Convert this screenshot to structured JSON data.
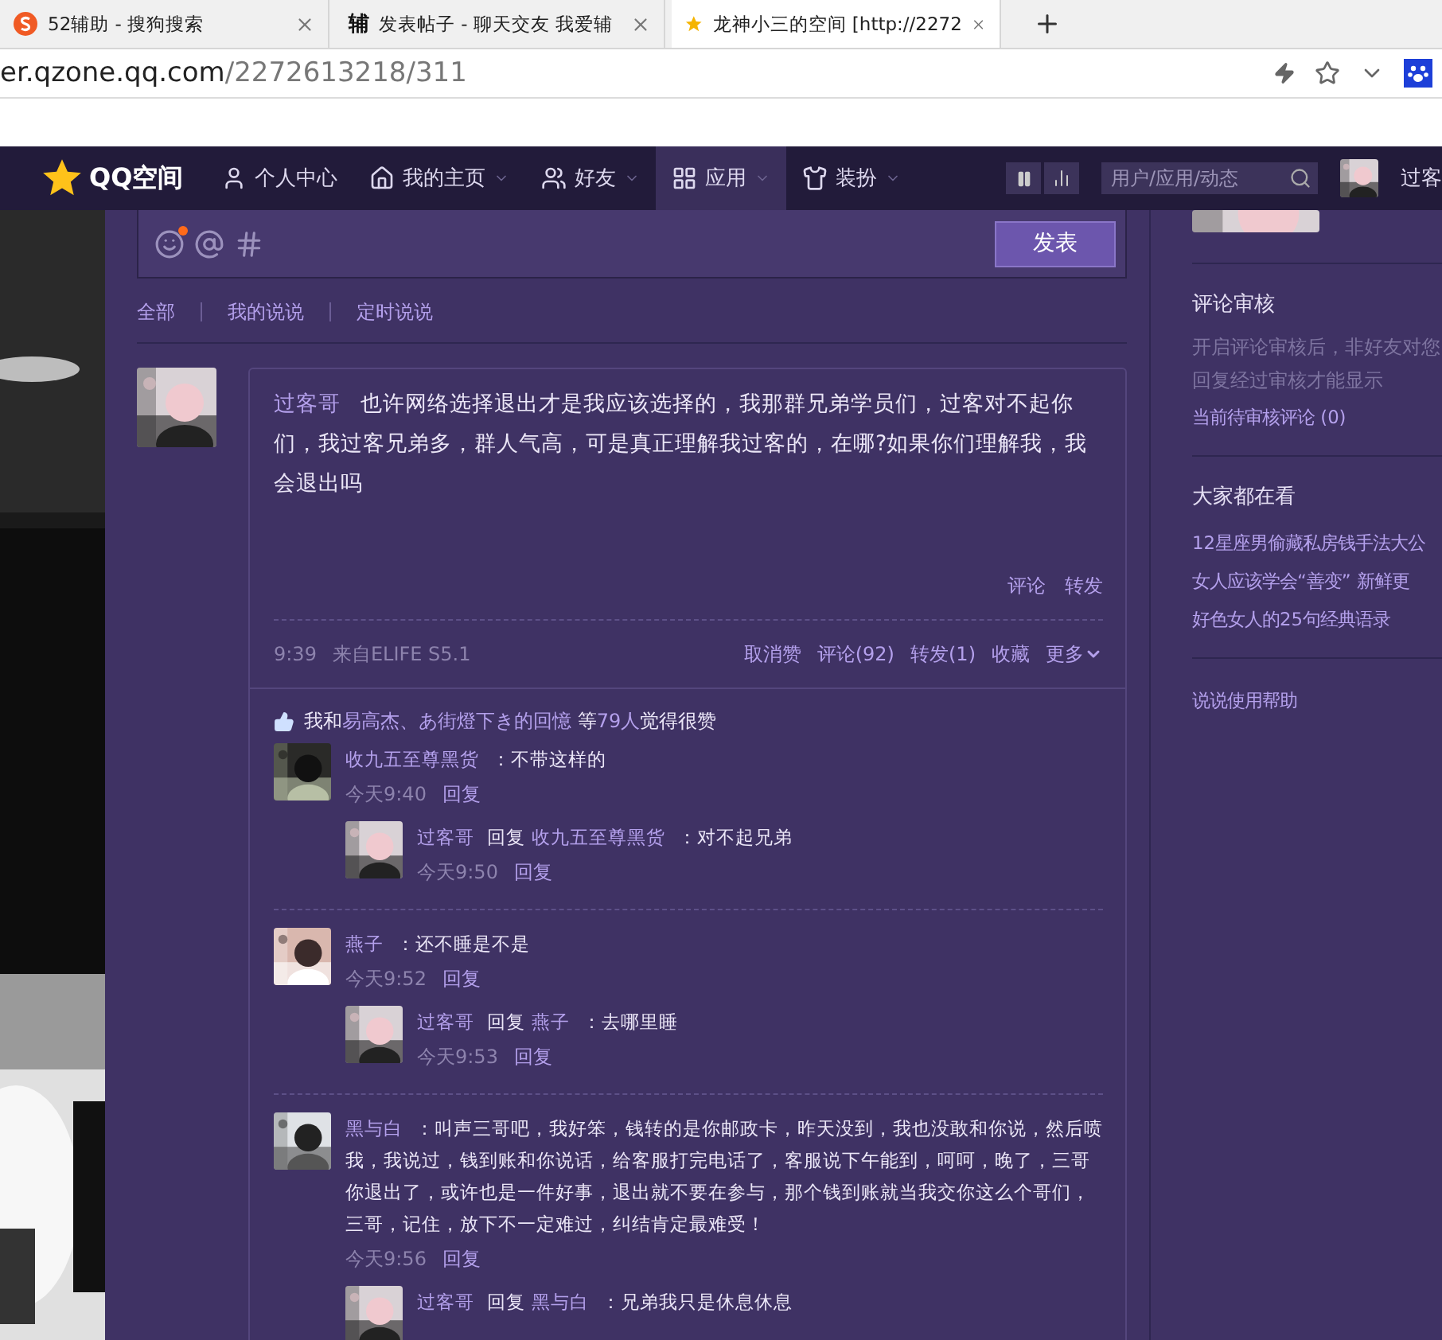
{
  "browser": {
    "tabs": [
      {
        "title": "52辅助 - 搜狗搜索",
        "selected": false
      },
      {
        "title": "发表帖子 - 聊天交友 我爱辅",
        "favicon": "辅",
        "selected": false
      },
      {
        "title": "龙神小三的空间 [http://2272",
        "selected": true
      }
    ],
    "address": {
      "host": "er.qzone.qq.com",
      "path": "/2272613218/311"
    }
  },
  "nav": {
    "logo": "QQ空间",
    "items": [
      {
        "label": "个人中心",
        "dropdown": false,
        "selected": false
      },
      {
        "label": "我的主页",
        "dropdown": true,
        "selected": false
      },
      {
        "label": "好友",
        "dropdown": true,
        "selected": false
      },
      {
        "label": "应用",
        "dropdown": true,
        "selected": true
      },
      {
        "label": "装扮",
        "dropdown": true,
        "selected": false
      }
    ],
    "search": {
      "placeholder": "用户/应用/动态"
    },
    "user": "过客"
  },
  "composer": {
    "emoji_dot": true,
    "button": "发表"
  },
  "filters": [
    "全部",
    "我的说说",
    "定时说说"
  ],
  "post": {
    "author": "过客哥",
    "text": "也许网络选择退出才是我应该选择的，我那群兄弟学员们，过客对不起你们，我过客兄弟多，群人气高，可是真正理解我过客的，在哪?如果你们理解我，我会退出吗",
    "inner_actions": [
      "评论",
      "转发"
    ],
    "time": "9:39",
    "source": "来自ELIFE S5.1",
    "actions": [
      "取消赞",
      "评论(92)",
      "转发(1)",
      "收藏",
      "更多"
    ],
    "likes": [
      {
        "text": "我和",
        "link": false
      },
      {
        "text": "易高杰、",
        "link": true
      },
      {
        "text": "あ街燈下き的回憶",
        "link": true
      },
      {
        "text": " 等",
        "link": false
      },
      {
        "text": "79人",
        "link": true
      },
      {
        "text": "觉得很赞",
        "link": false
      }
    ],
    "comments": [
      {
        "author": "收九五至尊黑货",
        "text": "：不带这样的",
        "time": "今天9:40",
        "reply": "回复",
        "replies": [
          {
            "author": "过客哥",
            "verb": "回复",
            "target": "收九五至尊黑货",
            "text": "：对不起兄弟",
            "time": "今天9:50",
            "reply": "回复"
          }
        ]
      },
      {
        "author": "燕子",
        "text": "：还不睡是不是",
        "time": "今天9:52",
        "reply": "回复",
        "replies": [
          {
            "author": "过客哥",
            "verb": "回复",
            "target": "燕子",
            "text": "：去哪里睡",
            "time": "今天9:53",
            "reply": "回复"
          }
        ]
      },
      {
        "author": "黑与白",
        "text": "：叫声三哥吧，我好笨，钱转的是你邮政卡，昨天没到，我也没敢和你说，然后喷我，我说过，钱到账和你说话，给客服打完电话了，客服说下午能到，呵呵，晚了，三哥你退出了，或许也是一件好事，退出就不要在参与，那个钱到账就当我交你这么个哥们，三哥，记住，放下不一定难过，纠结肯定最难受！",
        "time": "今天9:56",
        "reply": "回复",
        "replies": [
          {
            "author": "过客哥",
            "verb": "回复",
            "target": "黑与白",
            "text": "：兄弟我只是休息休息"
          }
        ]
      }
    ]
  },
  "sidebar": {
    "sections": [
      {
        "title": "评论审核",
        "notes": [
          "开启评论审核后，非好友对您",
          "回复经过审核才能显示"
        ],
        "links": [
          "当前待审核评论 (0)"
        ]
      },
      {
        "title": "大家都在看",
        "links": [
          "12星座男偷藏私房钱手法大公",
          "女人应该学会“善变” 新鲜更",
          "好色女人的25句经典语录"
        ]
      }
    ],
    "help": "说说使用帮助"
  }
}
